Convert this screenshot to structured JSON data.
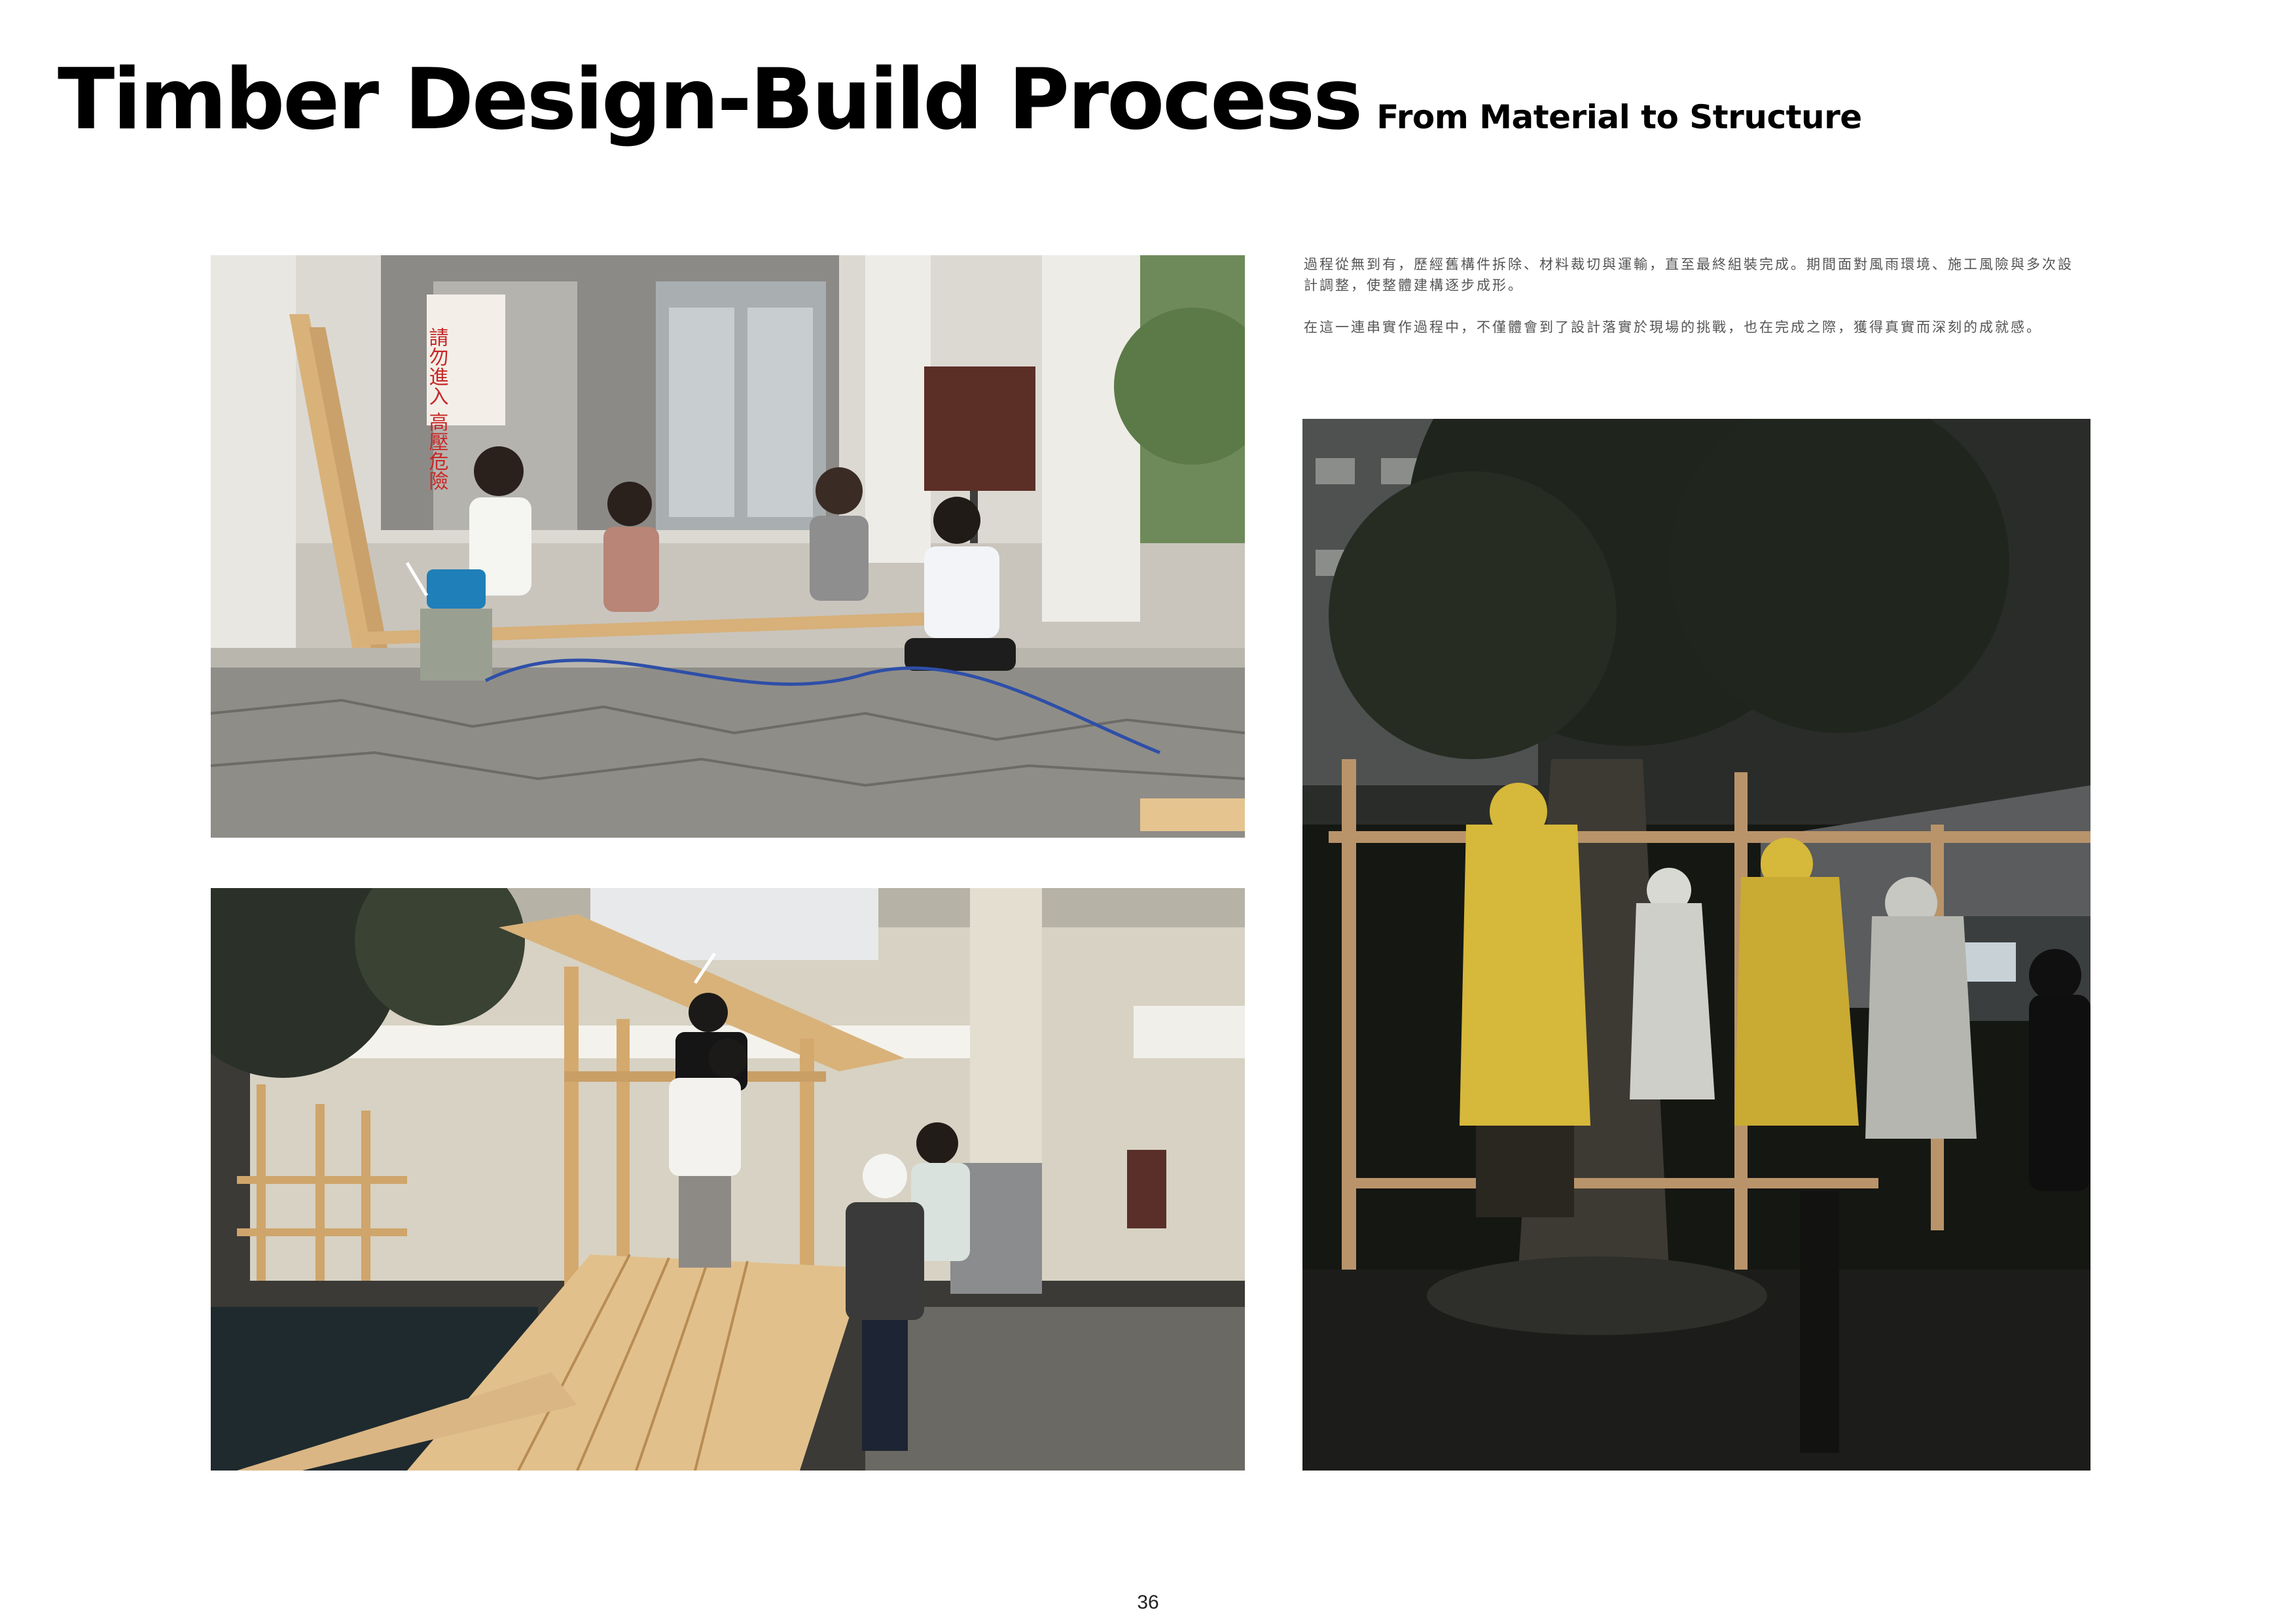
{
  "header": {
    "title": "Timber Design-Build Process",
    "subtitle": "From Material to Structure"
  },
  "body_text": {
    "paragraph_1": "過程從無到有，歷經舊構件拆除、材料裁切與運輸，直至最終組裝完成。期間面對風雨環境、施工風險與多次設計調整，使整體建構逐步成形。",
    "paragraph_2": "在這一連串實作過程中，不僅體會到了設計落實於現場的挑戰，也在完成之際，獲得真實而深刻的成就感。"
  },
  "photo_1": {
    "sign_text": "請勿進入 高壓危險"
  },
  "page_number": "36",
  "colors": {
    "text_primary": "#000000",
    "text_body": "#555555",
    "background": "#ffffff",
    "timber": "#d9b27a",
    "raincoat": "#d6b83a"
  }
}
